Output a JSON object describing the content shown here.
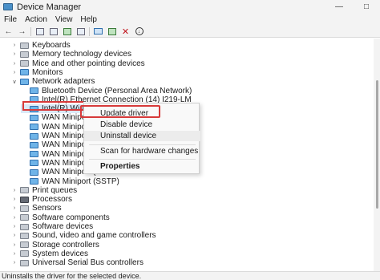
{
  "window": {
    "title": "Device Manager"
  },
  "menu": {
    "items": [
      "File",
      "Action",
      "View",
      "Help"
    ]
  },
  "tree": {
    "rows": [
      {
        "label": "Keyboards",
        "level": 1,
        "expanded": false,
        "icon": "keyboard-icon"
      },
      {
        "label": "Memory technology devices",
        "level": 1,
        "expanded": false,
        "icon": "memory-icon"
      },
      {
        "label": "Mice and other pointing devices",
        "level": 1,
        "expanded": false,
        "icon": "mouse-icon"
      },
      {
        "label": "Monitors",
        "level": 1,
        "expanded": false,
        "icon": "monitor-icon"
      },
      {
        "label": "Network adapters",
        "level": 1,
        "expanded": true,
        "icon": "network-icon"
      },
      {
        "label": "Bluetooth Device (Personal Area Network)",
        "level": 2,
        "icon": "network-adapter-icon"
      },
      {
        "label": "Intel(R) Ethernet Connection (14) I219-LM",
        "level": 2,
        "icon": "network-adapter-icon"
      },
      {
        "label": "Intel(R) Wi-Fi 6 A",
        "level": 2,
        "icon": "network-adapter-icon",
        "selected": true
      },
      {
        "label": "WAN Miniport (I",
        "level": 2,
        "icon": "network-adapter-icon"
      },
      {
        "label": "WAN Miniport (I",
        "level": 2,
        "icon": "network-adapter-icon"
      },
      {
        "label": "WAN Miniport (I",
        "level": 2,
        "icon": "network-adapter-icon"
      },
      {
        "label": "WAN Miniport (I",
        "level": 2,
        "icon": "network-adapter-icon"
      },
      {
        "label": "WAN Miniport (I",
        "level": 2,
        "icon": "network-adapter-icon"
      },
      {
        "label": "WAN Miniport (I",
        "level": 2,
        "icon": "network-adapter-icon"
      },
      {
        "label": "WAN Miniport (I",
        "level": 2,
        "icon": "network-adapter-icon"
      },
      {
        "label": "WAN Miniport (SSTP)",
        "level": 2,
        "icon": "network-adapter-icon"
      },
      {
        "label": "Print queues",
        "level": 1,
        "expanded": false,
        "icon": "printer-icon"
      },
      {
        "label": "Processors",
        "level": 1,
        "expanded": false,
        "icon": "processor-icon"
      },
      {
        "label": "Sensors",
        "level": 1,
        "expanded": false,
        "icon": "sensor-icon"
      },
      {
        "label": "Software components",
        "level": 1,
        "expanded": false,
        "icon": "software-component-icon"
      },
      {
        "label": "Software devices",
        "level": 1,
        "expanded": false,
        "icon": "software-device-icon"
      },
      {
        "label": "Sound, video and game controllers",
        "level": 1,
        "expanded": false,
        "icon": "sound-icon"
      },
      {
        "label": "Storage controllers",
        "level": 1,
        "expanded": false,
        "icon": "storage-icon"
      },
      {
        "label": "System devices",
        "level": 1,
        "expanded": false,
        "icon": "system-icon"
      },
      {
        "label": "Universal Serial Bus controllers",
        "level": 1,
        "expanded": false,
        "icon": "usb-icon"
      }
    ]
  },
  "context_menu": {
    "items": [
      {
        "label": "Update driver",
        "highlighted": true
      },
      {
        "label": "Disable device"
      },
      {
        "label": "Uninstall device",
        "hover": true
      },
      {
        "label": "Scan for hardware changes"
      },
      {
        "label": "Properties",
        "bold": true
      }
    ]
  },
  "status": {
    "text": "Uninstalls the driver for the selected device."
  },
  "colors": {
    "highlight": "#d73a3a",
    "accent": "#2f6fae"
  }
}
